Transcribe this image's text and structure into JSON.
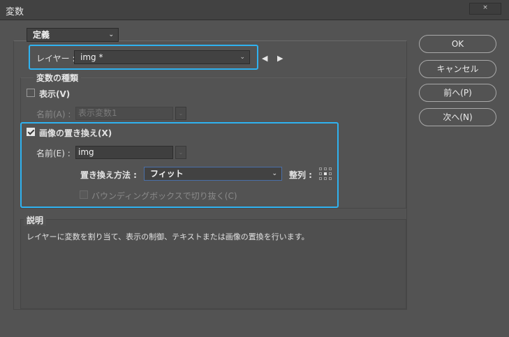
{
  "window": {
    "title": "変数",
    "close_glyph": "×"
  },
  "mode_select": {
    "value": "定義"
  },
  "layer": {
    "label": "レイヤー :",
    "value": "img *",
    "prev_glyph": "◀",
    "next_glyph": "▶"
  },
  "variable_types": {
    "title": "変数の種類"
  },
  "visibility": {
    "checkbox_label": "表示(V)",
    "checked": false,
    "name_label": "名前(A) :",
    "name_value": "表示変数1"
  },
  "pixel_replace": {
    "checkbox_label": "画像の置き換え(X)",
    "checked": true,
    "name_label": "名前(E) :",
    "name_value": "img",
    "method_label": "置き換え方法 :",
    "method_value": "フィット",
    "align_label": "整列 :",
    "bbox_label": "バウンディングボックスで切り抜く(C)"
  },
  "description": {
    "title": "説明",
    "text": "レイヤーに変数を割り当て、表示の制御、テキストまたは画像の置換を行います。"
  },
  "buttons": {
    "ok": "OK",
    "cancel": "キャンセル",
    "prev": "前へ(P)",
    "next": "次へ(N)"
  },
  "colors": {
    "highlight": "#2fb2f0",
    "background": "#535353"
  }
}
